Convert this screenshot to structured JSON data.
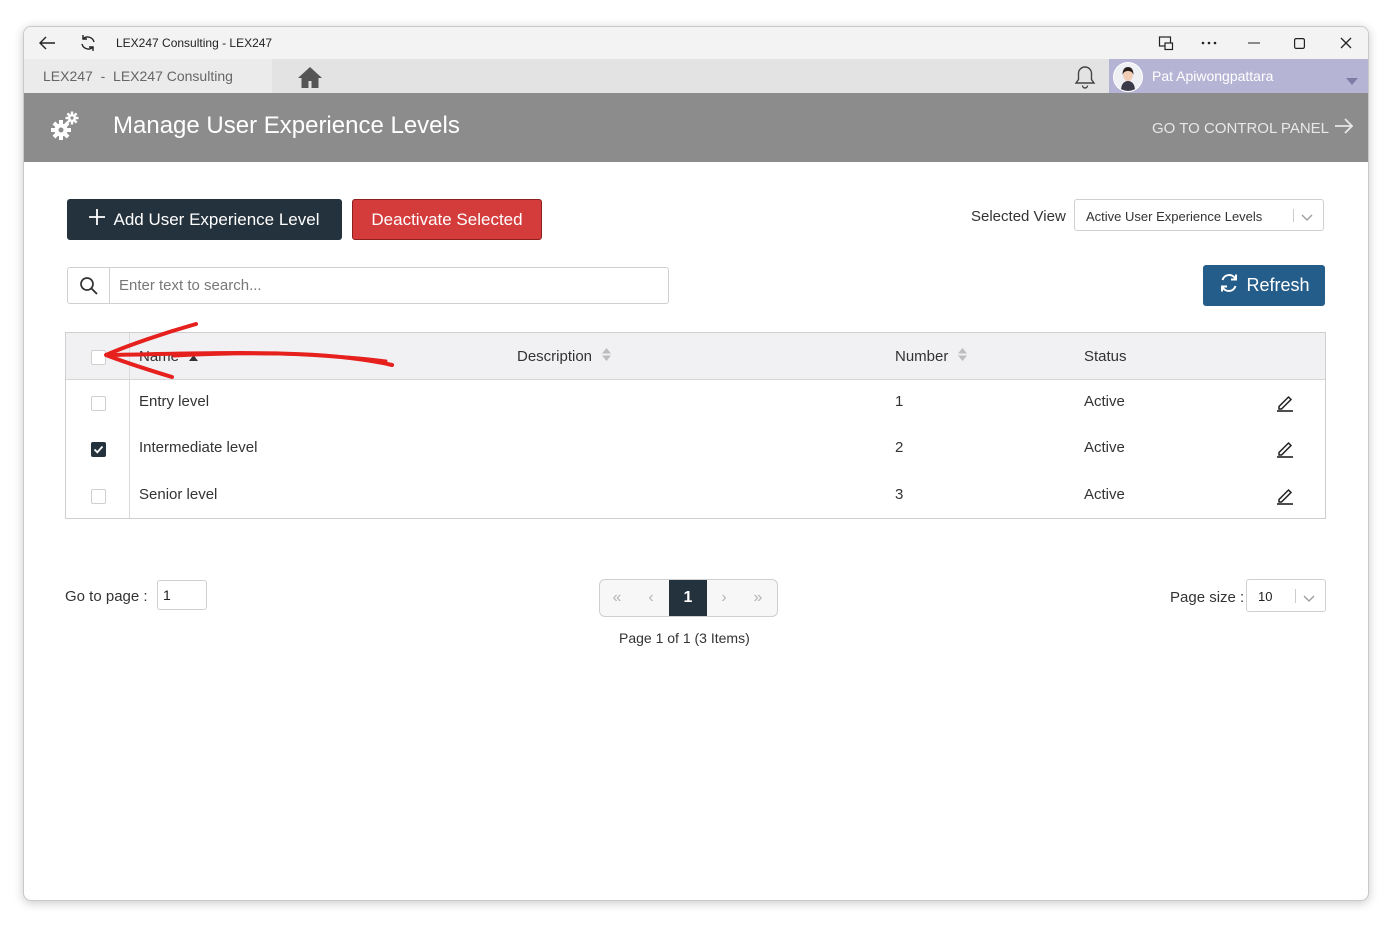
{
  "window": {
    "title": "LEX247 Consulting - LEX247",
    "icons": [
      "back-arrow-icon",
      "refresh-icon",
      "cast-icon",
      "more-icon",
      "minimize-icon",
      "maximize-icon",
      "close-icon"
    ]
  },
  "appbar": {
    "breadcrumb": "LEX247  -  LEX247 Consulting",
    "user_name": "Pat Apiwongpattara",
    "icons": [
      "home-icon",
      "bell-icon",
      "avatar",
      "caret-down-icon"
    ]
  },
  "header": {
    "title": "Manage User Experience Levels",
    "control_panel_link": "GO TO CONTROL PANEL",
    "colors": {
      "header_bg": "#8c8c8c",
      "user_bg": "#b6b4d4"
    }
  },
  "toolbar": {
    "add_label": "Add User Experience Level",
    "deactivate_label": "Deactivate Selected",
    "selected_view_label": "Selected View",
    "selected_view_value": "Active User Experience Levels",
    "search_placeholder": "Enter text to search...",
    "refresh_label": "Refresh",
    "colors": {
      "add_bg": "#24323d",
      "deactivate_bg": "#d43c3c",
      "refresh_bg": "#255d8a"
    }
  },
  "grid": {
    "columns": [
      "Name",
      "Description",
      "Number",
      "Status"
    ],
    "rows": [
      {
        "name": "Entry level",
        "description": "",
        "number": "1",
        "status": "Active",
        "checked": false
      },
      {
        "name": "Intermediate level",
        "description": "",
        "number": "2",
        "status": "Active",
        "checked": true
      },
      {
        "name": "Senior level",
        "description": "",
        "number": "3",
        "status": "Active",
        "checked": false
      }
    ]
  },
  "pagination": {
    "goto_label": "Go to page :",
    "goto_value": "1",
    "current_page": "1",
    "info": "Page 1 of 1 (3 Items)",
    "page_size_label": "Page size :",
    "page_size_value": "10"
  },
  "annotation": {
    "type": "red-arrow",
    "points_to": "select-all-checkbox",
    "color": "#e5201d"
  }
}
